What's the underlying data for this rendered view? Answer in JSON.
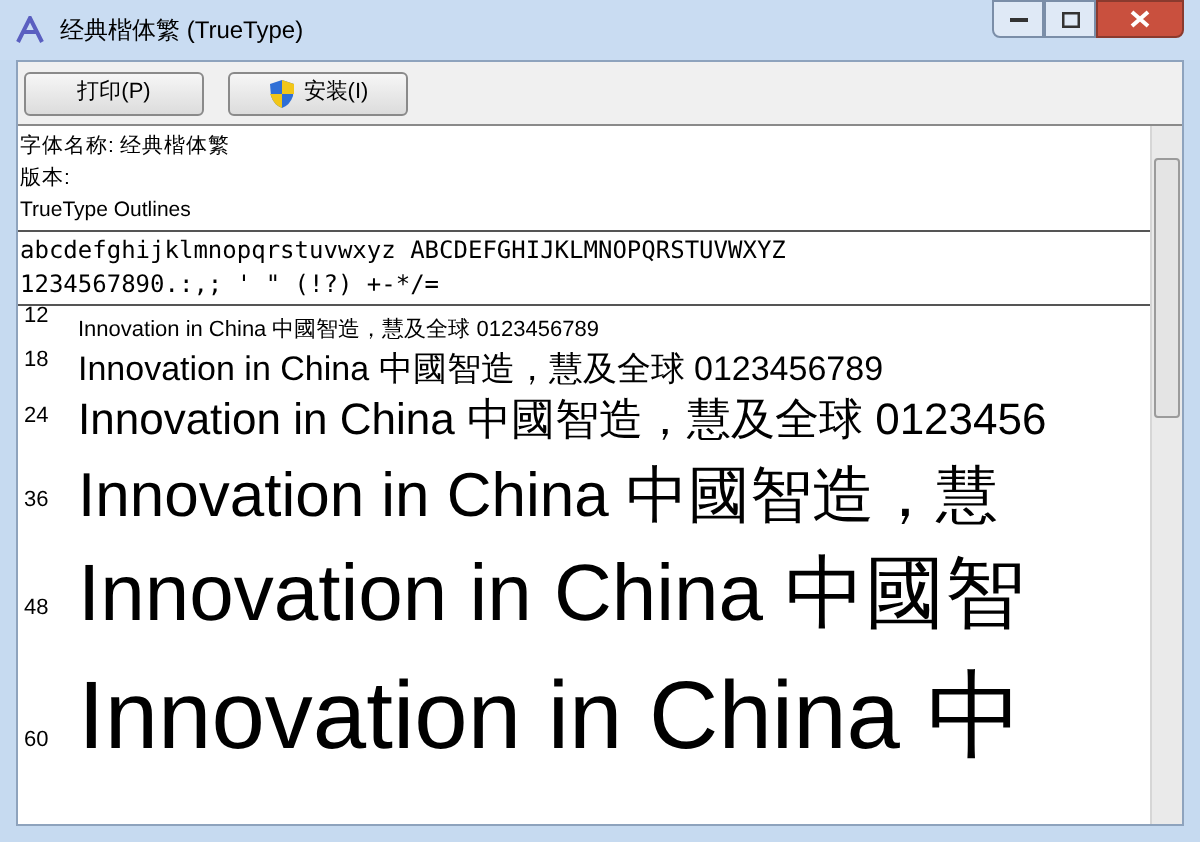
{
  "window": {
    "title": "经典楷体繁 (TrueType)"
  },
  "toolbar": {
    "buttons": [
      {
        "label": "打印(P)",
        "kind": "plain"
      },
      {
        "label": "安装(I)",
        "kind": "shield"
      }
    ]
  },
  "info": [
    "字体名称: 经典楷体繁",
    "版本:",
    "TrueType Outlines"
  ],
  "charset": [
    "abcdefghijklmnopqrstuvwxyz ABCDEFGHIJKLMNOPQRSTUVWXYZ",
    "1234567890.:,; ' \" (!?) +-*/="
  ],
  "samples": [
    {
      "size": "12",
      "text": "Innovation in China 中國智造，慧及全球 0123456789"
    },
    {
      "size": "18",
      "text": "Innovation in China 中國智造，慧及全球 0123456789"
    },
    {
      "size": "24",
      "text": "Innovation in China 中國智造，慧及全球 0123456"
    },
    {
      "size": "36",
      "text": "Innovation in China 中國智造，慧"
    },
    {
      "size": "48",
      "text": "Innovation in China 中國智"
    },
    {
      "size": "60",
      "text": "Innovation in China 中"
    }
  ]
}
